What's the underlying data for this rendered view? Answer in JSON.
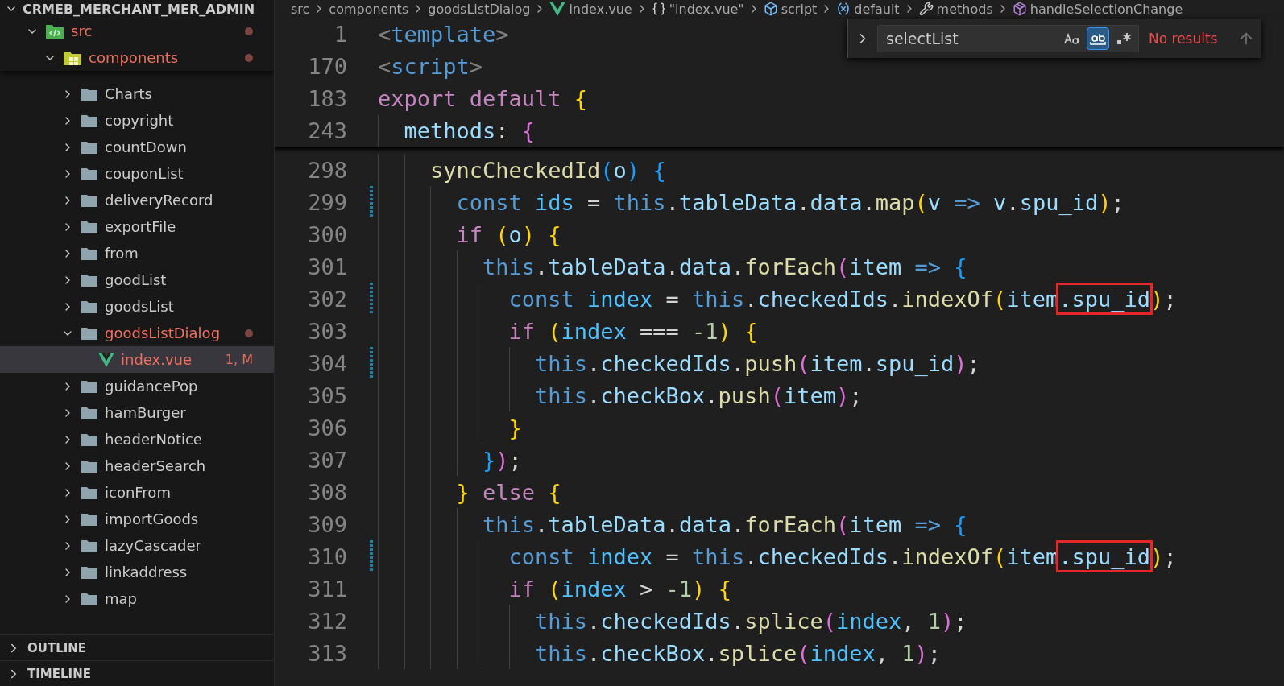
{
  "explorer": {
    "title": "CRMEB_MERCHANT_MER_ADMIN",
    "expanded": true,
    "tree": [
      {
        "name": "src",
        "kind": "src-folder",
        "expanded": true,
        "modified": true,
        "selected": false,
        "children": [
          {
            "name": "components",
            "kind": "components-folder",
            "expanded": true,
            "modified": true,
            "selected": false,
            "children": [
              {
                "name": "Charts",
                "kind": "folder",
                "expanded": false,
                "modified": false,
                "selected": false
              },
              {
                "name": "copyright",
                "kind": "folder",
                "expanded": false,
                "modified": false,
                "selected": false
              },
              {
                "name": "countDown",
                "kind": "folder",
                "expanded": false,
                "modified": false,
                "selected": false
              },
              {
                "name": "couponList",
                "kind": "folder",
                "expanded": false,
                "modified": false,
                "selected": false
              },
              {
                "name": "deliveryRecord",
                "kind": "folder",
                "expanded": false,
                "modified": false,
                "selected": false
              },
              {
                "name": "exportFile",
                "kind": "folder",
                "expanded": false,
                "modified": false,
                "selected": false
              },
              {
                "name": "from",
                "kind": "folder",
                "expanded": false,
                "modified": false,
                "selected": false
              },
              {
                "name": "goodList",
                "kind": "folder",
                "expanded": false,
                "modified": false,
                "selected": false
              },
              {
                "name": "goodsList",
                "kind": "folder",
                "expanded": false,
                "modified": false,
                "selected": false
              },
              {
                "name": "goodsListDialog",
                "kind": "folder",
                "expanded": true,
                "modified": true,
                "selected": false,
                "children": [
                  {
                    "name": "index.vue",
                    "kind": "vue",
                    "modified": true,
                    "badge": "1, M",
                    "selected": true
                  }
                ]
              },
              {
                "name": "guidancePop",
                "kind": "folder",
                "expanded": false,
                "modified": false,
                "selected": false
              },
              {
                "name": "hamBurger",
                "kind": "folder",
                "expanded": false,
                "modified": false,
                "selected": false
              },
              {
                "name": "headerNotice",
                "kind": "folder",
                "expanded": false,
                "modified": false,
                "selected": false
              },
              {
                "name": "headerSearch",
                "kind": "folder",
                "expanded": false,
                "modified": false,
                "selected": false
              },
              {
                "name": "iconFrom",
                "kind": "folder",
                "expanded": false,
                "modified": false,
                "selected": false
              },
              {
                "name": "importGoods",
                "kind": "folder",
                "expanded": false,
                "modified": false,
                "selected": false
              },
              {
                "name": "lazyCascader",
                "kind": "folder",
                "expanded": false,
                "modified": false,
                "selected": false
              },
              {
                "name": "linkaddress",
                "kind": "folder",
                "expanded": false,
                "modified": false,
                "selected": false
              },
              {
                "name": "map",
                "kind": "folder",
                "expanded": false,
                "modified": false,
                "selected": false
              }
            ]
          }
        ]
      }
    ]
  },
  "panels": [
    {
      "title": "OUTLINE",
      "expanded": false
    },
    {
      "title": "TIMELINE",
      "expanded": false
    }
  ],
  "breadcrumb": [
    {
      "label": "src",
      "kind": "text"
    },
    {
      "label": "components",
      "kind": "text"
    },
    {
      "label": "goodsListDialog",
      "kind": "text"
    },
    {
      "label": "index.vue",
      "kind": "vue"
    },
    {
      "label": "\"index.vue\"",
      "kind": "module"
    },
    {
      "label": "script",
      "kind": "element"
    },
    {
      "label": "default",
      "kind": "variable"
    },
    {
      "label": "methods",
      "kind": "method-group"
    },
    {
      "label": "handleSelectionChange",
      "kind": "method"
    }
  ],
  "find": {
    "value": "selectList",
    "result": "No results",
    "toggles": [
      {
        "kind": "case",
        "selected": false
      },
      {
        "kind": "word",
        "selected": true
      },
      {
        "kind": "regex",
        "selected": false
      }
    ]
  },
  "sticky_lines": [
    {
      "number": "1",
      "segs": [
        {
          "text": "<",
          "kind": "tag-punc"
        },
        {
          "text": "template",
          "kind": "tag"
        },
        {
          "text": ">",
          "kind": "tag-punc"
        }
      ]
    },
    {
      "number": "170",
      "segs": [
        {
          "text": "<",
          "kind": "tag-punc"
        },
        {
          "text": "script",
          "kind": "tag"
        },
        {
          "text": ">",
          "kind": "tag-punc"
        }
      ]
    },
    {
      "number": "183",
      "segs": [
        {
          "text": "export default",
          "kind": "control"
        },
        {
          "text": " {",
          "kind": "bracket",
          "color": "#ffd700"
        }
      ],
      "children": [
        {
          "number": "243",
          "segs": [
            {
              "text": "methods",
              "kind": "variable"
            },
            {
              "text": ":",
              "kind": "plain"
            },
            {
              "text": " {",
              "kind": "bracket",
              "color": "#da70d6"
            }
          ]
        }
      ]
    }
  ],
  "lines": [
    {
      "number": "298",
      "modified": false,
      "segs": [
        {
          "text": "syncCheckedId",
          "kind": "function"
        },
        {
          "text": "(",
          "kind": "bracket",
          "color": "#179fff"
        },
        {
          "text": "o",
          "kind": "variable"
        },
        {
          "text": ")",
          "kind": "bracket",
          "color": "#179fff"
        },
        {
          "text": " {",
          "kind": "bracket",
          "color": "#179fff"
        }
      ],
      "children": [
        {
          "number": "299",
          "modified": true,
          "segs": [
            {
              "text": "const",
              "kind": "keyword"
            },
            {
              "text": " ids",
              "kind": "constant"
            },
            {
              "text": " = ",
              "kind": "plain"
            },
            {
              "text": "this",
              "kind": "keyword"
            },
            {
              "text": ".",
              "kind": "plain"
            },
            {
              "text": "tableData",
              "kind": "variable"
            },
            {
              "text": ".",
              "kind": "plain"
            },
            {
              "text": "data",
              "kind": "variable"
            },
            {
              "text": ".",
              "kind": "plain"
            },
            {
              "text": "map",
              "kind": "function"
            },
            {
              "text": "(",
              "kind": "bracket",
              "color": "#ffd700"
            },
            {
              "text": "v ",
              "kind": "variable"
            },
            {
              "text": "=>",
              "kind": "keyword"
            },
            {
              "text": " v",
              "kind": "variable"
            },
            {
              "text": ".",
              "kind": "plain"
            },
            {
              "text": "spu_id",
              "kind": "variable"
            },
            {
              "text": ")",
              "kind": "bracket",
              "color": "#ffd700"
            },
            {
              "text": ";",
              "kind": "plain"
            }
          ]
        },
        {
          "number": "300",
          "modified": false,
          "segs": [
            {
              "text": "if",
              "kind": "control"
            },
            {
              "text": " (",
              "kind": "bracket",
              "color": "#ffd700"
            },
            {
              "text": "o",
              "kind": "variable"
            },
            {
              "text": ")",
              "kind": "bracket",
              "color": "#ffd700"
            },
            {
              "text": " {",
              "kind": "bracket",
              "color": "#ffd700"
            }
          ],
          "children": [
            {
              "number": "301",
              "modified": false,
              "segs": [
                {
                  "text": "this",
                  "kind": "keyword"
                },
                {
                  "text": ".",
                  "kind": "plain"
                },
                {
                  "text": "tableData",
                  "kind": "variable"
                },
                {
                  "text": ".",
                  "kind": "plain"
                },
                {
                  "text": "data",
                  "kind": "variable"
                },
                {
                  "text": ".",
                  "kind": "plain"
                },
                {
                  "text": "forEach",
                  "kind": "function"
                },
                {
                  "text": "(",
                  "kind": "bracket",
                  "color": "#da70d6"
                },
                {
                  "text": "item ",
                  "kind": "variable"
                },
                {
                  "text": "=>",
                  "kind": "keyword"
                },
                {
                  "text": " {",
                  "kind": "bracket",
                  "color": "#179fff"
                }
              ],
              "children": [
                {
                  "number": "302",
                  "modified": true,
                  "segs": [
                    {
                      "text": "const",
                      "kind": "keyword"
                    },
                    {
                      "text": " index",
                      "kind": "constant"
                    },
                    {
                      "text": " = ",
                      "kind": "plain"
                    },
                    {
                      "text": "this",
                      "kind": "keyword"
                    },
                    {
                      "text": ".",
                      "kind": "plain"
                    },
                    {
                      "text": "checkedIds",
                      "kind": "variable"
                    },
                    {
                      "text": ".",
                      "kind": "plain"
                    },
                    {
                      "text": "indexOf",
                      "kind": "function"
                    },
                    {
                      "text": "(",
                      "kind": "bracket",
                      "color": "#ffd700"
                    },
                    {
                      "text": "item",
                      "kind": "variable"
                    },
                    {
                      "text": ".spu_id",
                      "kind": "variable",
                      "boxed": true
                    },
                    {
                      "text": ")",
                      "kind": "bracket",
                      "color": "#ffd700"
                    },
                    {
                      "text": ";",
                      "kind": "plain"
                    }
                  ]
                },
                {
                  "number": "303",
                  "modified": false,
                  "segs": [
                    {
                      "text": "if",
                      "kind": "control"
                    },
                    {
                      "text": " (",
                      "kind": "bracket",
                      "color": "#ffd700"
                    },
                    {
                      "text": "index",
                      "kind": "constant"
                    },
                    {
                      "text": " === ",
                      "kind": "plain"
                    },
                    {
                      "text": "-1",
                      "kind": "number"
                    },
                    {
                      "text": ")",
                      "kind": "bracket",
                      "color": "#ffd700"
                    },
                    {
                      "text": " {",
                      "kind": "bracket",
                      "color": "#ffd700"
                    }
                  ],
                  "children": [
                    {
                      "number": "304",
                      "modified": true,
                      "segs": [
                        {
                          "text": "this",
                          "kind": "keyword"
                        },
                        {
                          "text": ".",
                          "kind": "plain"
                        },
                        {
                          "text": "checkedIds",
                          "kind": "variable"
                        },
                        {
                          "text": ".",
                          "kind": "plain"
                        },
                        {
                          "text": "push",
                          "kind": "function"
                        },
                        {
                          "text": "(",
                          "kind": "bracket",
                          "color": "#da70d6"
                        },
                        {
                          "text": "item",
                          "kind": "variable"
                        },
                        {
                          "text": ".",
                          "kind": "plain"
                        },
                        {
                          "text": "spu_id",
                          "kind": "variable"
                        },
                        {
                          "text": ")",
                          "kind": "bracket",
                          "color": "#da70d6"
                        },
                        {
                          "text": ";",
                          "kind": "plain"
                        }
                      ]
                    },
                    {
                      "number": "305",
                      "modified": false,
                      "segs": [
                        {
                          "text": "this",
                          "kind": "keyword"
                        },
                        {
                          "text": ".",
                          "kind": "plain"
                        },
                        {
                          "text": "checkBox",
                          "kind": "variable"
                        },
                        {
                          "text": ".",
                          "kind": "plain"
                        },
                        {
                          "text": "push",
                          "kind": "function"
                        },
                        {
                          "text": "(",
                          "kind": "bracket",
                          "color": "#da70d6"
                        },
                        {
                          "text": "item",
                          "kind": "variable"
                        },
                        {
                          "text": ")",
                          "kind": "bracket",
                          "color": "#da70d6"
                        },
                        {
                          "text": ";",
                          "kind": "plain"
                        }
                      ]
                    }
                  ]
                },
                {
                  "number": "306",
                  "modified": false,
                  "segs": [
                    {
                      "text": "}",
                      "kind": "bracket",
                      "color": "#ffd700"
                    }
                  ]
                }
              ]
            },
            {
              "number": "307",
              "modified": false,
              "segs": [
                {
                  "text": "}",
                  "kind": "bracket",
                  "color": "#179fff"
                },
                {
                  "text": ")",
                  "kind": "bracket",
                  "color": "#da70d6"
                },
                {
                  "text": ";",
                  "kind": "plain"
                }
              ]
            }
          ]
        },
        {
          "number": "308",
          "modified": false,
          "segs": [
            {
              "text": "}",
              "kind": "bracket",
              "color": "#ffd700"
            },
            {
              "text": " else",
              "kind": "control"
            },
            {
              "text": " {",
              "kind": "bracket",
              "color": "#ffd700"
            }
          ],
          "children": [
            {
              "number": "309",
              "modified": false,
              "segs": [
                {
                  "text": "this",
                  "kind": "keyword"
                },
                {
                  "text": ".",
                  "kind": "plain"
                },
                {
                  "text": "tableData",
                  "kind": "variable"
                },
                {
                  "text": ".",
                  "kind": "plain"
                },
                {
                  "text": "data",
                  "kind": "variable"
                },
                {
                  "text": ".",
                  "kind": "plain"
                },
                {
                  "text": "forEach",
                  "kind": "function"
                },
                {
                  "text": "(",
                  "kind": "bracket",
                  "color": "#da70d6"
                },
                {
                  "text": "item ",
                  "kind": "variable"
                },
                {
                  "text": "=>",
                  "kind": "keyword"
                },
                {
                  "text": " {",
                  "kind": "bracket",
                  "color": "#179fff"
                }
              ],
              "children": [
                {
                  "number": "310",
                  "modified": true,
                  "segs": [
                    {
                      "text": "const",
                      "kind": "keyword"
                    },
                    {
                      "text": " index",
                      "kind": "constant"
                    },
                    {
                      "text": " = ",
                      "kind": "plain"
                    },
                    {
                      "text": "this",
                      "kind": "keyword"
                    },
                    {
                      "text": ".",
                      "kind": "plain"
                    },
                    {
                      "text": "checkedIds",
                      "kind": "variable"
                    },
                    {
                      "text": ".",
                      "kind": "plain"
                    },
                    {
                      "text": "indexOf",
                      "kind": "function"
                    },
                    {
                      "text": "(",
                      "kind": "bracket",
                      "color": "#ffd700"
                    },
                    {
                      "text": "item",
                      "kind": "variable"
                    },
                    {
                      "text": ".spu_id",
                      "kind": "variable",
                      "boxed": true
                    },
                    {
                      "text": ")",
                      "kind": "bracket",
                      "color": "#ffd700"
                    },
                    {
                      "text": ";",
                      "kind": "plain"
                    }
                  ]
                },
                {
                  "number": "311",
                  "modified": false,
                  "segs": [
                    {
                      "text": "if",
                      "kind": "control"
                    },
                    {
                      "text": " (",
                      "kind": "bracket",
                      "color": "#ffd700"
                    },
                    {
                      "text": "index",
                      "kind": "constant"
                    },
                    {
                      "text": " > ",
                      "kind": "plain"
                    },
                    {
                      "text": "-1",
                      "kind": "number"
                    },
                    {
                      "text": ")",
                      "kind": "bracket",
                      "color": "#ffd700"
                    },
                    {
                      "text": " {",
                      "kind": "bracket",
                      "color": "#ffd700"
                    }
                  ],
                  "children": [
                    {
                      "number": "312",
                      "modified": false,
                      "segs": [
                        {
                          "text": "this",
                          "kind": "keyword"
                        },
                        {
                          "text": ".",
                          "kind": "plain"
                        },
                        {
                          "text": "checkedIds",
                          "kind": "variable"
                        },
                        {
                          "text": ".",
                          "kind": "plain"
                        },
                        {
                          "text": "splice",
                          "kind": "function"
                        },
                        {
                          "text": "(",
                          "kind": "bracket",
                          "color": "#da70d6"
                        },
                        {
                          "text": "index",
                          "kind": "constant"
                        },
                        {
                          "text": ", ",
                          "kind": "plain"
                        },
                        {
                          "text": "1",
                          "kind": "number"
                        },
                        {
                          "text": ")",
                          "kind": "bracket",
                          "color": "#da70d6"
                        },
                        {
                          "text": ";",
                          "kind": "plain"
                        }
                      ]
                    },
                    {
                      "number": "313",
                      "modified": false,
                      "segs": [
                        {
                          "text": "this",
                          "kind": "keyword"
                        },
                        {
                          "text": ".",
                          "kind": "plain"
                        },
                        {
                          "text": "checkBox",
                          "kind": "variable"
                        },
                        {
                          "text": ".",
                          "kind": "plain"
                        },
                        {
                          "text": "splice",
                          "kind": "function"
                        },
                        {
                          "text": "(",
                          "kind": "bracket",
                          "color": "#da70d6"
                        },
                        {
                          "text": "index",
                          "kind": "constant"
                        },
                        {
                          "text": ", ",
                          "kind": "plain"
                        },
                        {
                          "text": "1",
                          "kind": "number"
                        },
                        {
                          "text": ")",
                          "kind": "bracket",
                          "color": "#da70d6"
                        },
                        {
                          "text": ";",
                          "kind": "plain"
                        }
                      ]
                    }
                  ]
                }
              ]
            }
          ]
        }
      ]
    }
  ]
}
